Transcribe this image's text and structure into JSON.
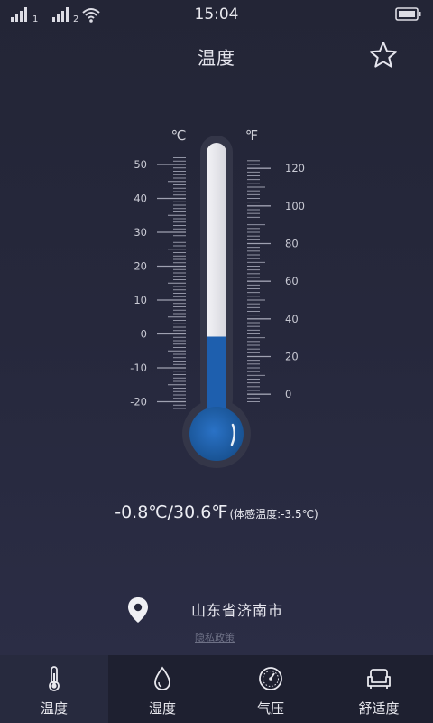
{
  "status_bar": {
    "time": "15:04",
    "sim1": "1",
    "sim2": "2"
  },
  "header": {
    "title": "温度",
    "favorite_icon": "star-outline-icon"
  },
  "thermometer": {
    "celsius_label": "℃",
    "fahrenheit_label": "℉",
    "celsius_ticks": [
      "50",
      "40",
      "30",
      "20",
      "10",
      "0",
      "-10",
      "-20"
    ],
    "fahrenheit_ticks": [
      "120",
      "100",
      "80",
      "60",
      "40",
      "20",
      "0"
    ],
    "current_celsius": -0.8,
    "mercury_color": "#1e5fae",
    "tube_color": "#e9e9ee"
  },
  "reading": {
    "main": "-0.8℃/30.6℉",
    "feels_like": "(体感温度:-3.5℃)"
  },
  "location": {
    "icon": "map-pin-icon",
    "text": "山东省济南市"
  },
  "privacy_link": "隐私政策",
  "bottom_nav": {
    "items": [
      {
        "label": "温度",
        "icon": "thermometer-icon",
        "active": true
      },
      {
        "label": "湿度",
        "icon": "droplet-icon",
        "active": false
      },
      {
        "label": "气压",
        "icon": "gauge-icon",
        "active": false
      },
      {
        "label": "舒适度",
        "icon": "sofa-icon",
        "active": false
      }
    ]
  }
}
